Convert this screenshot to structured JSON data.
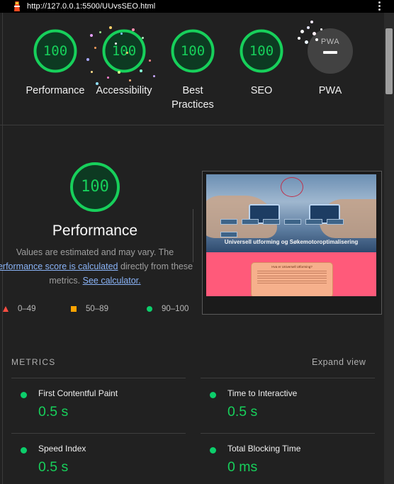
{
  "browser": {
    "url": "http://127.0.0.1:5500/UUvsSEO.html"
  },
  "summary": {
    "gauges": [
      {
        "score": "100",
        "label": "Performance"
      },
      {
        "score": "100",
        "label": "Accessibility"
      },
      {
        "score": "100",
        "label": "Best Practices"
      },
      {
        "score": "100",
        "label": "SEO"
      }
    ],
    "pwa": {
      "badge_text": "PWA",
      "label": "PWA"
    }
  },
  "performance": {
    "score": "100",
    "title": "Performance",
    "desc_1": "Values are estimated and may vary. The",
    "link_score": "performance score is calculated",
    "desc_2": " directly from these",
    "desc_3": "metrics. ",
    "link_calc": "See calculator.",
    "legend": [
      {
        "range": "0–49",
        "color": "#ff4e42"
      },
      {
        "range": "50–89",
        "color": "#ffa400"
      },
      {
        "range": "90–100",
        "color": "#0cce6b"
      }
    ]
  },
  "screenshot_page": {
    "hero_title": "Universell utforming og Søkemotoroptimalisering",
    "card_title": "Hva er Universell Utforming?"
  },
  "metrics": {
    "header": "METRICS",
    "expand_label": "Expand view",
    "items": [
      {
        "name": "First Contentful Paint",
        "value": "0.5 s"
      },
      {
        "name": "Time to Interactive",
        "value": "0.5 s"
      },
      {
        "name": "Speed Index",
        "value": "0.5 s"
      },
      {
        "name": "Total Blocking Time",
        "value": "0 ms"
      }
    ]
  },
  "colors": {
    "pass": "#0cce6b",
    "average": "#ffa400",
    "fail": "#ff4e42",
    "background": "#212121"
  }
}
